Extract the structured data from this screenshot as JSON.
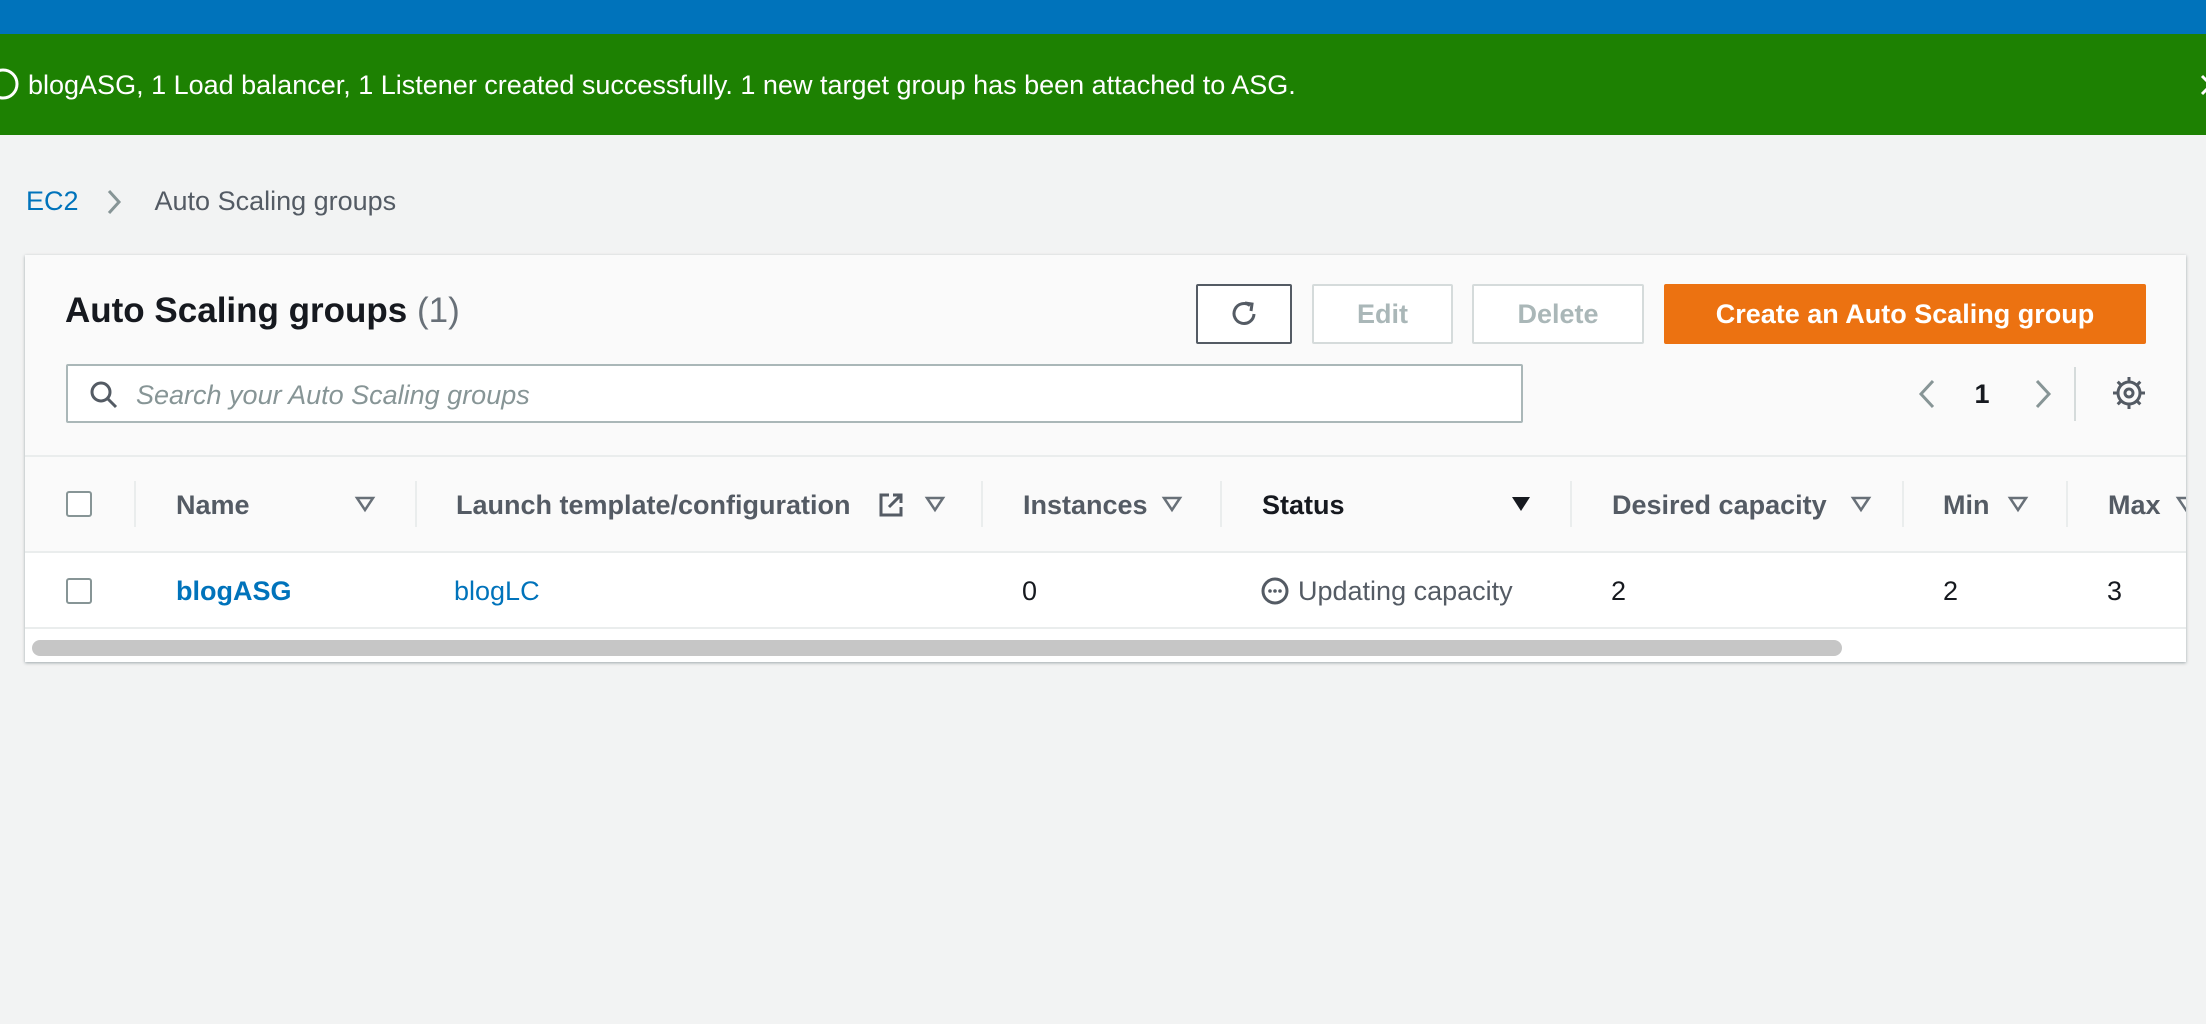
{
  "flash": {
    "message": "blogASG, 1 Load balancer, 1 Listener created successfully. 1 new target group has been attached to ASG."
  },
  "breadcrumb": {
    "root": "EC2",
    "current": "Auto Scaling groups"
  },
  "header": {
    "title": "Auto Scaling groups",
    "count": "(1)",
    "edit_label": "Edit",
    "delete_label": "Delete",
    "create_label": "Create an Auto Scaling group"
  },
  "search": {
    "placeholder": "Search your Auto Scaling groups"
  },
  "pagination": {
    "current_page": "1"
  },
  "table": {
    "columns": {
      "name": "Name",
      "launch": "Launch template/configuration",
      "instances": "Instances",
      "status": "Status",
      "desired": "Desired capacity",
      "min": "Min",
      "max": "Max"
    },
    "rows": [
      {
        "name": "blogASG",
        "launch": "blogLC",
        "instances": "0",
        "status": "Updating capacity",
        "desired": "2",
        "min": "2",
        "max": "3"
      }
    ]
  },
  "colors": {
    "topbar": "#0073bb",
    "flash_success": "#1d8102",
    "primary_button": "#ec7211",
    "link": "#0073bb"
  },
  "icons": {
    "flash": "status-success-icon",
    "flash_close": "close-icon",
    "breadcrumb_separator": "chevron-right-icon",
    "refresh": "refresh-icon",
    "search": "search-icon",
    "pager_prev": "chevron-left-icon",
    "pager_next": "chevron-right-icon",
    "settings": "gear-icon",
    "sort": "caret-down-icon",
    "external": "external-link-icon",
    "status": "in-progress-icon"
  }
}
